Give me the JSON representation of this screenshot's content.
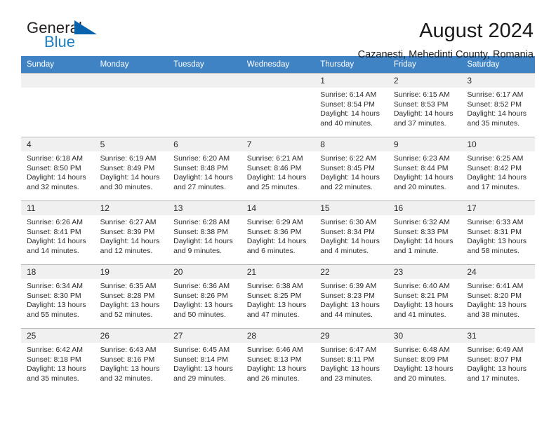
{
  "brand": {
    "name_part1": "General",
    "name_part2": "Blue",
    "logo_icon": "triangle-mark"
  },
  "header": {
    "title": "August 2024",
    "subtitle": "Cazanesti, Mehedinti County, Romania"
  },
  "calendar": {
    "weekday_headers": [
      "Sunday",
      "Monday",
      "Tuesday",
      "Wednesday",
      "Thursday",
      "Friday",
      "Saturday"
    ],
    "accent_color": "#3f83c4",
    "daynum_band_color": "#f0f0f0",
    "weeks": [
      [
        {
          "day": "",
          "sunrise": "",
          "sunset": "",
          "daylight_line1": "",
          "daylight_line2": ""
        },
        {
          "day": "",
          "sunrise": "",
          "sunset": "",
          "daylight_line1": "",
          "daylight_line2": ""
        },
        {
          "day": "",
          "sunrise": "",
          "sunset": "",
          "daylight_line1": "",
          "daylight_line2": ""
        },
        {
          "day": "",
          "sunrise": "",
          "sunset": "",
          "daylight_line1": "",
          "daylight_line2": ""
        },
        {
          "day": "1",
          "sunrise": "Sunrise: 6:14 AM",
          "sunset": "Sunset: 8:54 PM",
          "daylight_line1": "Daylight: 14 hours",
          "daylight_line2": "and 40 minutes."
        },
        {
          "day": "2",
          "sunrise": "Sunrise: 6:15 AM",
          "sunset": "Sunset: 8:53 PM",
          "daylight_line1": "Daylight: 14 hours",
          "daylight_line2": "and 37 minutes."
        },
        {
          "day": "3",
          "sunrise": "Sunrise: 6:17 AM",
          "sunset": "Sunset: 8:52 PM",
          "daylight_line1": "Daylight: 14 hours",
          "daylight_line2": "and 35 minutes."
        }
      ],
      [
        {
          "day": "4",
          "sunrise": "Sunrise: 6:18 AM",
          "sunset": "Sunset: 8:50 PM",
          "daylight_line1": "Daylight: 14 hours",
          "daylight_line2": "and 32 minutes."
        },
        {
          "day": "5",
          "sunrise": "Sunrise: 6:19 AM",
          "sunset": "Sunset: 8:49 PM",
          "daylight_line1": "Daylight: 14 hours",
          "daylight_line2": "and 30 minutes."
        },
        {
          "day": "6",
          "sunrise": "Sunrise: 6:20 AM",
          "sunset": "Sunset: 8:48 PM",
          "daylight_line1": "Daylight: 14 hours",
          "daylight_line2": "and 27 minutes."
        },
        {
          "day": "7",
          "sunrise": "Sunrise: 6:21 AM",
          "sunset": "Sunset: 8:46 PM",
          "daylight_line1": "Daylight: 14 hours",
          "daylight_line2": "and 25 minutes."
        },
        {
          "day": "8",
          "sunrise": "Sunrise: 6:22 AM",
          "sunset": "Sunset: 8:45 PM",
          "daylight_line1": "Daylight: 14 hours",
          "daylight_line2": "and 22 minutes."
        },
        {
          "day": "9",
          "sunrise": "Sunrise: 6:23 AM",
          "sunset": "Sunset: 8:44 PM",
          "daylight_line1": "Daylight: 14 hours",
          "daylight_line2": "and 20 minutes."
        },
        {
          "day": "10",
          "sunrise": "Sunrise: 6:25 AM",
          "sunset": "Sunset: 8:42 PM",
          "daylight_line1": "Daylight: 14 hours",
          "daylight_line2": "and 17 minutes."
        }
      ],
      [
        {
          "day": "11",
          "sunrise": "Sunrise: 6:26 AM",
          "sunset": "Sunset: 8:41 PM",
          "daylight_line1": "Daylight: 14 hours",
          "daylight_line2": "and 14 minutes."
        },
        {
          "day": "12",
          "sunrise": "Sunrise: 6:27 AM",
          "sunset": "Sunset: 8:39 PM",
          "daylight_line1": "Daylight: 14 hours",
          "daylight_line2": "and 12 minutes."
        },
        {
          "day": "13",
          "sunrise": "Sunrise: 6:28 AM",
          "sunset": "Sunset: 8:38 PM",
          "daylight_line1": "Daylight: 14 hours",
          "daylight_line2": "and 9 minutes."
        },
        {
          "day": "14",
          "sunrise": "Sunrise: 6:29 AM",
          "sunset": "Sunset: 8:36 PM",
          "daylight_line1": "Daylight: 14 hours",
          "daylight_line2": "and 6 minutes."
        },
        {
          "day": "15",
          "sunrise": "Sunrise: 6:30 AM",
          "sunset": "Sunset: 8:34 PM",
          "daylight_line1": "Daylight: 14 hours",
          "daylight_line2": "and 4 minutes."
        },
        {
          "day": "16",
          "sunrise": "Sunrise: 6:32 AM",
          "sunset": "Sunset: 8:33 PM",
          "daylight_line1": "Daylight: 14 hours",
          "daylight_line2": "and 1 minute."
        },
        {
          "day": "17",
          "sunrise": "Sunrise: 6:33 AM",
          "sunset": "Sunset: 8:31 PM",
          "daylight_line1": "Daylight: 13 hours",
          "daylight_line2": "and 58 minutes."
        }
      ],
      [
        {
          "day": "18",
          "sunrise": "Sunrise: 6:34 AM",
          "sunset": "Sunset: 8:30 PM",
          "daylight_line1": "Daylight: 13 hours",
          "daylight_line2": "and 55 minutes."
        },
        {
          "day": "19",
          "sunrise": "Sunrise: 6:35 AM",
          "sunset": "Sunset: 8:28 PM",
          "daylight_line1": "Daylight: 13 hours",
          "daylight_line2": "and 52 minutes."
        },
        {
          "day": "20",
          "sunrise": "Sunrise: 6:36 AM",
          "sunset": "Sunset: 8:26 PM",
          "daylight_line1": "Daylight: 13 hours",
          "daylight_line2": "and 50 minutes."
        },
        {
          "day": "21",
          "sunrise": "Sunrise: 6:38 AM",
          "sunset": "Sunset: 8:25 PM",
          "daylight_line1": "Daylight: 13 hours",
          "daylight_line2": "and 47 minutes."
        },
        {
          "day": "22",
          "sunrise": "Sunrise: 6:39 AM",
          "sunset": "Sunset: 8:23 PM",
          "daylight_line1": "Daylight: 13 hours",
          "daylight_line2": "and 44 minutes."
        },
        {
          "day": "23",
          "sunrise": "Sunrise: 6:40 AM",
          "sunset": "Sunset: 8:21 PM",
          "daylight_line1": "Daylight: 13 hours",
          "daylight_line2": "and 41 minutes."
        },
        {
          "day": "24",
          "sunrise": "Sunrise: 6:41 AM",
          "sunset": "Sunset: 8:20 PM",
          "daylight_line1": "Daylight: 13 hours",
          "daylight_line2": "and 38 minutes."
        }
      ],
      [
        {
          "day": "25",
          "sunrise": "Sunrise: 6:42 AM",
          "sunset": "Sunset: 8:18 PM",
          "daylight_line1": "Daylight: 13 hours",
          "daylight_line2": "and 35 minutes."
        },
        {
          "day": "26",
          "sunrise": "Sunrise: 6:43 AM",
          "sunset": "Sunset: 8:16 PM",
          "daylight_line1": "Daylight: 13 hours",
          "daylight_line2": "and 32 minutes."
        },
        {
          "day": "27",
          "sunrise": "Sunrise: 6:45 AM",
          "sunset": "Sunset: 8:14 PM",
          "daylight_line1": "Daylight: 13 hours",
          "daylight_line2": "and 29 minutes."
        },
        {
          "day": "28",
          "sunrise": "Sunrise: 6:46 AM",
          "sunset": "Sunset: 8:13 PM",
          "daylight_line1": "Daylight: 13 hours",
          "daylight_line2": "and 26 minutes."
        },
        {
          "day": "29",
          "sunrise": "Sunrise: 6:47 AM",
          "sunset": "Sunset: 8:11 PM",
          "daylight_line1": "Daylight: 13 hours",
          "daylight_line2": "and 23 minutes."
        },
        {
          "day": "30",
          "sunrise": "Sunrise: 6:48 AM",
          "sunset": "Sunset: 8:09 PM",
          "daylight_line1": "Daylight: 13 hours",
          "daylight_line2": "and 20 minutes."
        },
        {
          "day": "31",
          "sunrise": "Sunrise: 6:49 AM",
          "sunset": "Sunset: 8:07 PM",
          "daylight_line1": "Daylight: 13 hours",
          "daylight_line2": "and 17 minutes."
        }
      ]
    ]
  }
}
